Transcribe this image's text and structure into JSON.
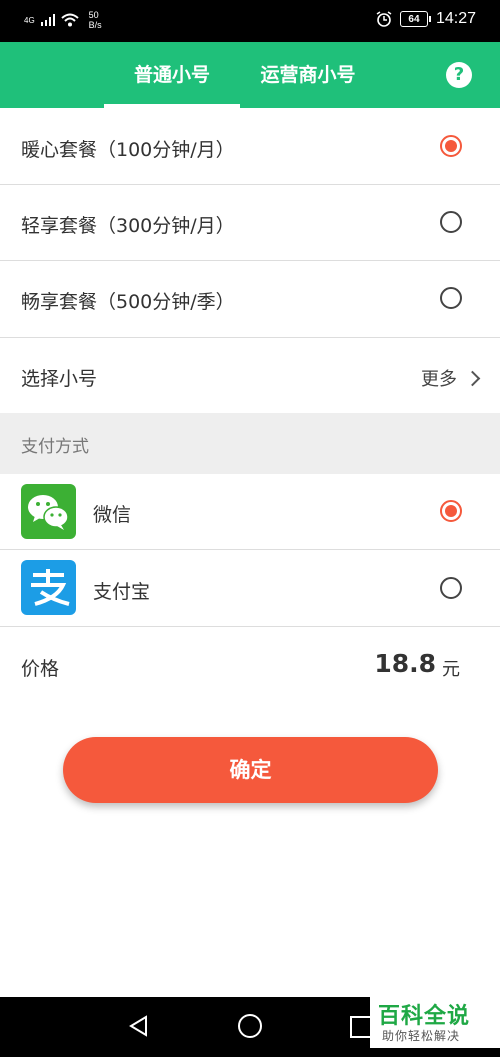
{
  "status_bar": {
    "network": "4G",
    "speed_top": "50",
    "speed_bottom": "B/s",
    "battery": "64",
    "time": "14:27"
  },
  "header": {
    "tabs": [
      {
        "label": "普通小号",
        "active": true
      },
      {
        "label": "运营商小号",
        "active": false
      }
    ],
    "help_symbol": "?"
  },
  "plans": [
    {
      "label": "暖心套餐（100分钟/月）",
      "selected": true
    },
    {
      "label": "轻享套餐（300分钟/月）",
      "selected": false
    },
    {
      "label": "畅享套餐（500分钟/季）",
      "selected": false
    }
  ],
  "select_number": {
    "label": "选择小号",
    "more": "更多"
  },
  "payment": {
    "section_title": "支付方式",
    "methods": [
      {
        "label": "微信",
        "icon": "wechat-icon",
        "selected": true
      },
      {
        "label": "支付宝",
        "icon": "alipay-icon",
        "selected": false
      }
    ]
  },
  "price": {
    "label": "价格",
    "value": "18.8",
    "unit": "元"
  },
  "confirm_label": "确定",
  "watermark": {
    "title": "百科全说",
    "subtitle": "助你轻松解决"
  },
  "colors": {
    "brand_green": "#1fc07a",
    "accent_orange": "#f5593c",
    "wechat_green": "#3cb034",
    "alipay_blue": "#1c9de6"
  }
}
